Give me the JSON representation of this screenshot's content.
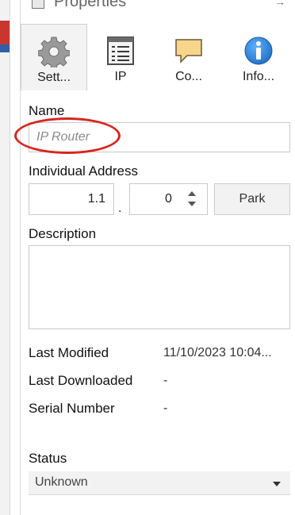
{
  "panel": {
    "title": "Properties",
    "pin_glyph": "→"
  },
  "tabs": [
    {
      "label": "Sett...",
      "icon": "gear-icon",
      "active": true
    },
    {
      "label": "IP",
      "icon": "list-window-icon",
      "active": false
    },
    {
      "label": "Co...",
      "icon": "comment-icon",
      "active": false
    },
    {
      "label": "Info...",
      "icon": "info-icon",
      "active": false
    }
  ],
  "form": {
    "name_label": "Name",
    "name_placeholder": "IP Router",
    "address_label": "Individual Address",
    "address_prefix": "1.1",
    "address_separator": ".",
    "address_value": "0",
    "park_label": "Park",
    "description_label": "Description",
    "description_value": ""
  },
  "info": {
    "last_modified_label": "Last Modified",
    "last_modified_value": "11/10/2023 10:04...",
    "last_downloaded_label": "Last Downloaded",
    "last_downloaded_value": "-",
    "serial_number_label": "Serial Number",
    "serial_number_value": "-"
  },
  "status": {
    "label": "Status",
    "value": "Unknown"
  },
  "colors": {
    "highlight": "#d7261e",
    "info_blue": "#1f6fc4",
    "comment_yellow": "#f7d58a"
  }
}
